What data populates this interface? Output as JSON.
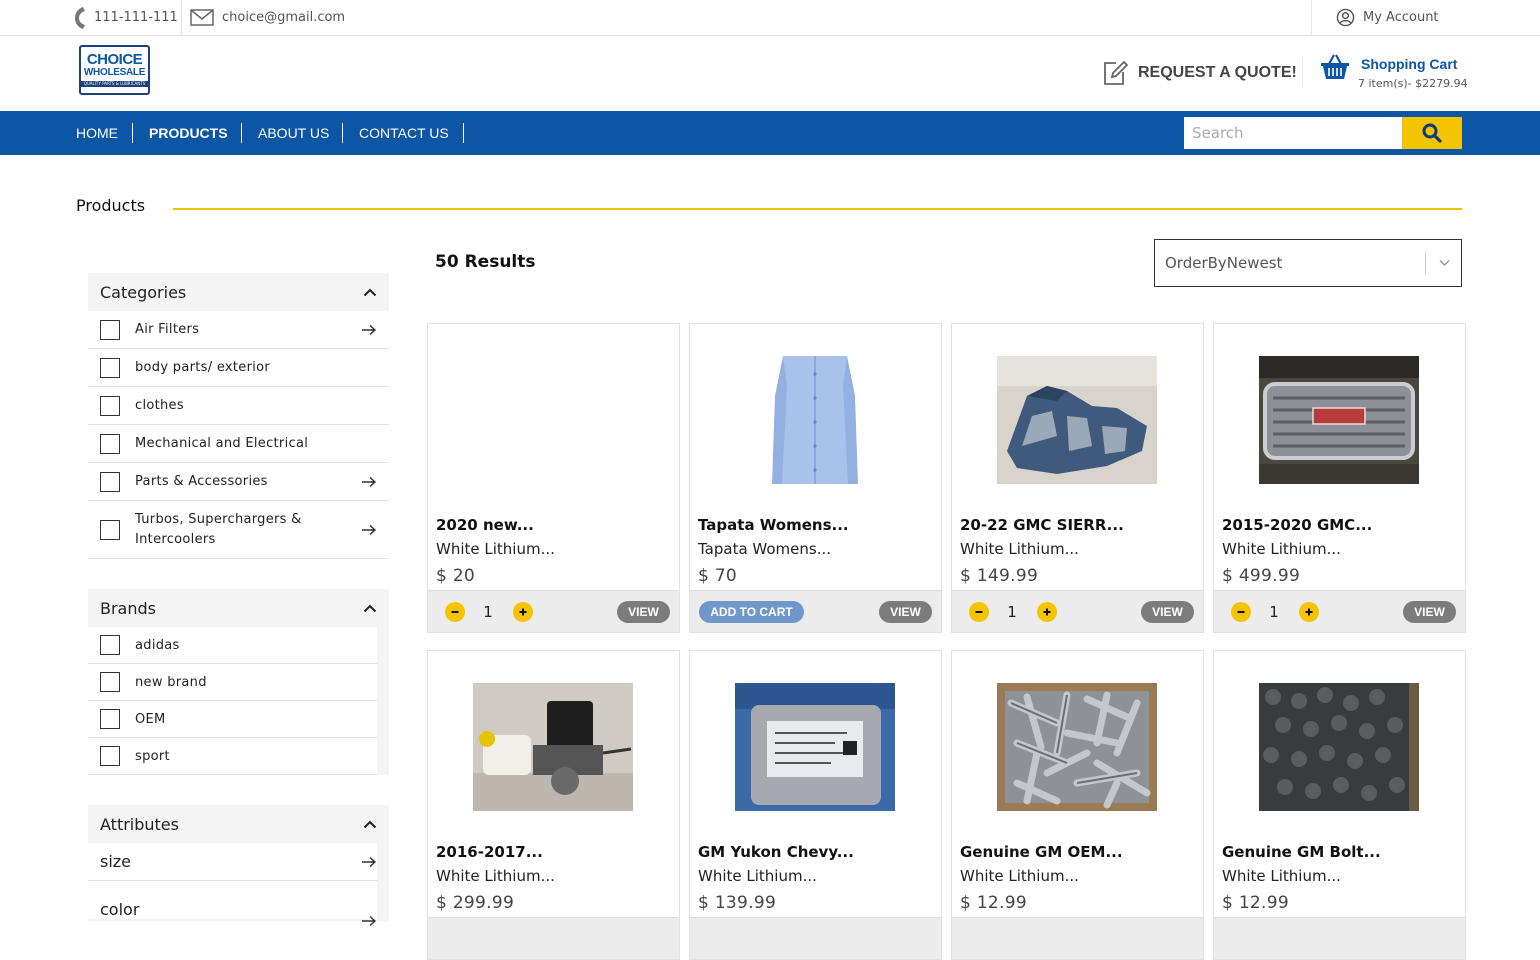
{
  "topbar": {
    "phone": "111-111-111",
    "email": "choice@gmail.com",
    "account": "My Account"
  },
  "header": {
    "logo_line1": "CHOICE",
    "logo_line2": "WHOLESALE",
    "logo_line3": "QUALITY PARTS & LUBRICANTS",
    "quote_label": "REQUEST A QUOTE!",
    "cart_title": "Shopping Cart",
    "cart_summary": "7 item(s)- $2279.94"
  },
  "nav": {
    "items": [
      "HOME",
      "PRODUCTS",
      "ABOUT US",
      "CONTACT US"
    ],
    "active": "PRODUCTS",
    "search_placeholder": "Search"
  },
  "page": {
    "title": "Products",
    "results": "50 Results",
    "sort_value": "OrderByNewest"
  },
  "sidebar": {
    "categories_title": "Categories",
    "categories": [
      {
        "label": "Air Filters",
        "has_children": true
      },
      {
        "label": "body parts/ exterior",
        "has_children": false
      },
      {
        "label": "clothes",
        "has_children": false
      },
      {
        "label": "Mechanical and Electrical",
        "has_children": false
      },
      {
        "label": "Parts & Accessories",
        "has_children": true
      },
      {
        "label": "Turbos, Superchargers & Intercoolers",
        "has_children": true
      }
    ],
    "brands_title": "Brands",
    "brands": [
      "adidas",
      "new brand",
      "OEM",
      "sport"
    ],
    "attributes_title": "Attributes",
    "attributes": [
      "size",
      "color"
    ]
  },
  "products": [
    {
      "name": "2020 new...",
      "sub": "White Lithium...",
      "price": "$ 20",
      "qty": "1",
      "view": "VIEW",
      "image": "none"
    },
    {
      "name": "Tapata Womens...",
      "sub": "Tapata Womens...",
      "price": "$ 70",
      "add": "ADD TO CART",
      "view": "VIEW",
      "image": "shirt"
    },
    {
      "name": "20-22 GMC SIERR...",
      "sub": "White Lithium...",
      "price": "$ 149.99",
      "qty": "1",
      "view": "VIEW",
      "image": "bracket"
    },
    {
      "name": "2015-2020 GMC...",
      "sub": "White Lithium...",
      "price": "$ 499.99",
      "qty": "1",
      "view": "VIEW",
      "image": "grille"
    },
    {
      "name": "2016-2017...",
      "sub": "White Lithium...",
      "price": "$ 299.99",
      "image": "brake-unit"
    },
    {
      "name": "GM Yukon Chevy...",
      "sub": "White Lithium...",
      "price": "$ 139.99",
      "image": "ecu-module"
    },
    {
      "name": "Genuine GM OEM...",
      "sub": "White Lithium...",
      "price": "$ 12.99",
      "image": "bolts-box"
    },
    {
      "name": "Genuine GM Bolt...",
      "sub": "White Lithium...",
      "price": "$ 12.99",
      "image": "bolts-dark"
    }
  ],
  "colors": {
    "brand_blue": "#0d55a5",
    "accent_yellow": "#f5c400"
  }
}
